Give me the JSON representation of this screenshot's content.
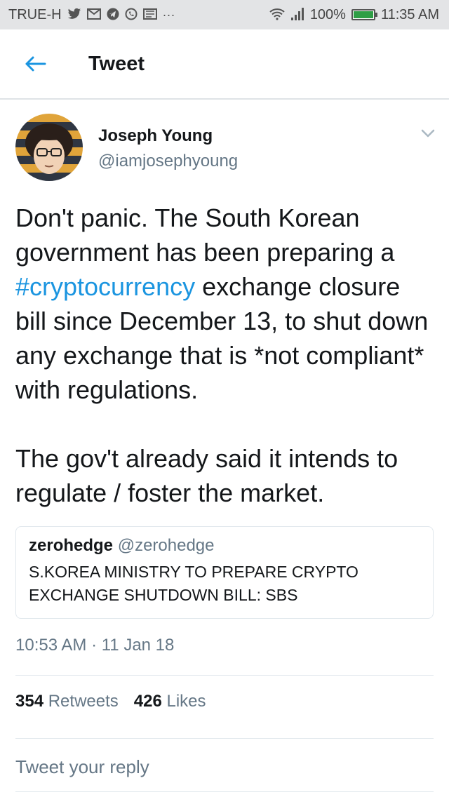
{
  "status_bar": {
    "carrier": "TRUE-H",
    "notification_icons": [
      "twitter-icon",
      "gmail-icon",
      "telegram-icon",
      "whatsapp-icon",
      "email-icon",
      "more-icon"
    ],
    "signal": "wifi-icon",
    "battery": "100%",
    "time": "11:35 AM"
  },
  "header": {
    "title": "Tweet"
  },
  "tweet": {
    "author_name": "Joseph Young",
    "author_handle": "@iamjosephyoung",
    "text_before_hashtag": "Don't panic. The South Korean government has been preparing a ",
    "hashtag": "#cryptocurrency",
    "text_after_hashtag": " exchange closure bill since December 13, to shut down any exchange that is *not compliant* with regulations.\n\nThe gov't already said it intends to regulate / foster the market.",
    "timestamp": "10:53 AM · 11 Jan 18",
    "retweets_count": "354",
    "retweets_label": "Retweets",
    "likes_count": "426",
    "likes_label": "Likes"
  },
  "quoted_tweet": {
    "name": "zerohedge",
    "handle": "@zerohedge",
    "text": "S.KOREA MINISTRY TO PREPARE CRYPTO EXCHANGE SHUTDOWN BILL: SBS"
  },
  "reply": {
    "placeholder": "Tweet your reply"
  },
  "colors": {
    "accent": "#1b95e0",
    "text": "#14171a",
    "secondary": "#657786",
    "status_bar_bg": "#e3e4e6"
  }
}
